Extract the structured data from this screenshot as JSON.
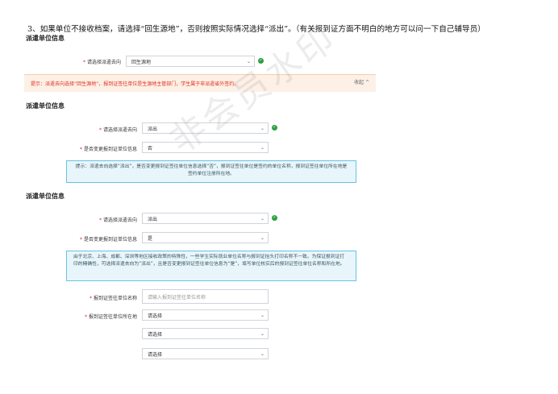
{
  "instruction_note": "3、如果单位不接收档案，请选择“回生源地”，否则按照实际情况选择“派出”。（有关报到证方面不明白的地方可以问一下自己辅导员）",
  "section_title": "派遣单位信息",
  "labels": {
    "dispatch_direction": "请选择派遣去向",
    "change_report_unit": "是否变更报到证单位信息",
    "report_unit_name": "报到证签往单位名称",
    "report_unit_location": "报到证签往单位所在地",
    "required_mark": "*"
  },
  "block1": {
    "dispatch_value": "回生源地",
    "warning_text": "提示：派遣去向选择“回生源地”，报到证签往单位是生源地主管部门，学生属于非派遣省外签约。",
    "collapse_label": "收起 ^"
  },
  "block2": {
    "dispatch_value": "派出",
    "change_value": "否",
    "info_text": "提示：派遣去向选择“派出”，是否变更报到证签往单位信息选择“否”，报到证签往单位是签约的单位名称，报到证签往单位所在地是签约单位注册所在地。"
  },
  "block3": {
    "dispatch_value": "派出",
    "change_value": "是",
    "info_text": "由于北京、上海、成都、深圳等地区接收政策的特殊性，一些学生实际就业单位名称与报到证抬头打印名称不一致。为保证报到证打印的精确性，可选择派遣去向为“派出”，且是否变更报到证签往单位信息为“是”，填写单位核实后的报到证签往单位名称和所在地。",
    "name_placeholder": "请输入报到证签往单位名称",
    "location_select_1": "请选择",
    "location_select_2": "请选择",
    "location_select_3": "请选择"
  },
  "icons": {
    "check": "✓",
    "chevron": "⌄"
  },
  "watermark_text": "非会员水印",
  "colors": {
    "success_green": "#2e9e41",
    "warning_bg": "#fdf0e6",
    "warning_text": "#e0301e",
    "info_border": "#67c3e4",
    "info_bg": "#e8f6fb",
    "required_red": "#e02020"
  }
}
